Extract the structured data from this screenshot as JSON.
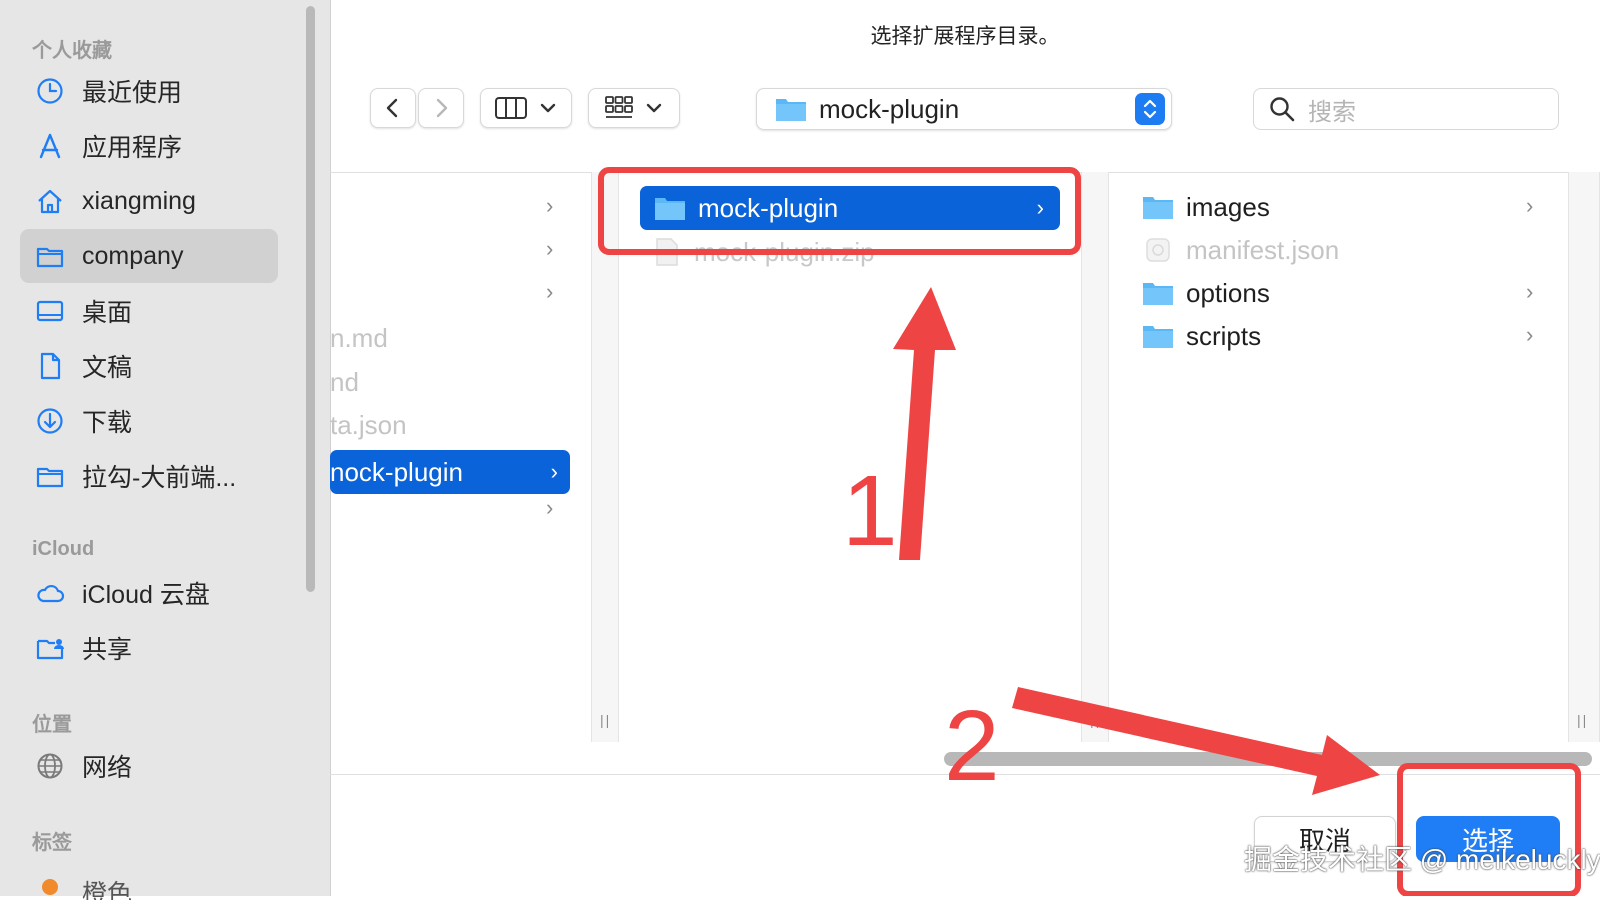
{
  "dialog": {
    "title": "选择扩展程序目录。"
  },
  "sidebar": {
    "sections": {
      "favorites": "个人收藏",
      "icloud": "iCloud",
      "locations": "位置",
      "tags": "标签"
    },
    "favorites": [
      {
        "label": "最近使用",
        "icon": "clock-icon"
      },
      {
        "label": "应用程序",
        "icon": "applications-icon"
      },
      {
        "label": "xiangming",
        "icon": "home-icon"
      },
      {
        "label": "company",
        "icon": "folder-icon",
        "selected": true
      },
      {
        "label": "桌面",
        "icon": "desktop-icon"
      },
      {
        "label": "文稿",
        "icon": "document-icon"
      },
      {
        "label": "下载",
        "icon": "download-icon"
      },
      {
        "label": "拉勾-大前端...",
        "icon": "folder-icon"
      }
    ],
    "icloud": [
      {
        "label": "iCloud 云盘",
        "icon": "cloud-icon"
      },
      {
        "label": "共享",
        "icon": "shared-folder-icon"
      }
    ],
    "locations": [
      {
        "label": "网络",
        "icon": "globe-icon"
      }
    ],
    "tags_partial": "橙色"
  },
  "toolbar": {
    "back_icon": "chevron-left-icon",
    "forward_icon": "chevron-right-icon",
    "view_icon": "columns-icon",
    "group_icon": "grid-icon",
    "path_label": "mock-plugin",
    "search_placeholder": "搜索"
  },
  "columns": {
    "col1": {
      "items": [
        {
          "label": "",
          "has_children": true
        },
        {
          "label": "",
          "has_children": true
        },
        {
          "label": "",
          "has_children": true
        },
        {
          "label": "n.md",
          "dim": true
        },
        {
          "label": "nd",
          "dim": true
        },
        {
          "label": "ta.json",
          "dim": true
        },
        {
          "label": "nock-plugin",
          "selected": true,
          "has_children": true
        },
        {
          "label": "",
          "has_children": true
        }
      ]
    },
    "col2": {
      "items": [
        {
          "label": "mock-plugin",
          "selected": true,
          "has_children": true
        },
        {
          "label": "mock-plugin.zip",
          "dim": true
        }
      ]
    },
    "col3": {
      "items": [
        {
          "label": "images",
          "has_children": true
        },
        {
          "label": "manifest.json",
          "dim": true
        },
        {
          "label": "options",
          "has_children": true
        },
        {
          "label": "scripts",
          "has_children": true
        }
      ]
    }
  },
  "buttons": {
    "cancel": "取消",
    "choose": "选择"
  },
  "annotations": {
    "step1": "1",
    "step2": "2",
    "arrow_color": "#ee4444"
  },
  "watermark": "掘金技术社区 @ meikeluckly",
  "colors": {
    "accent": "#1f7ef5",
    "selection": "#0a63d8",
    "folder": "#5bb8f5"
  }
}
